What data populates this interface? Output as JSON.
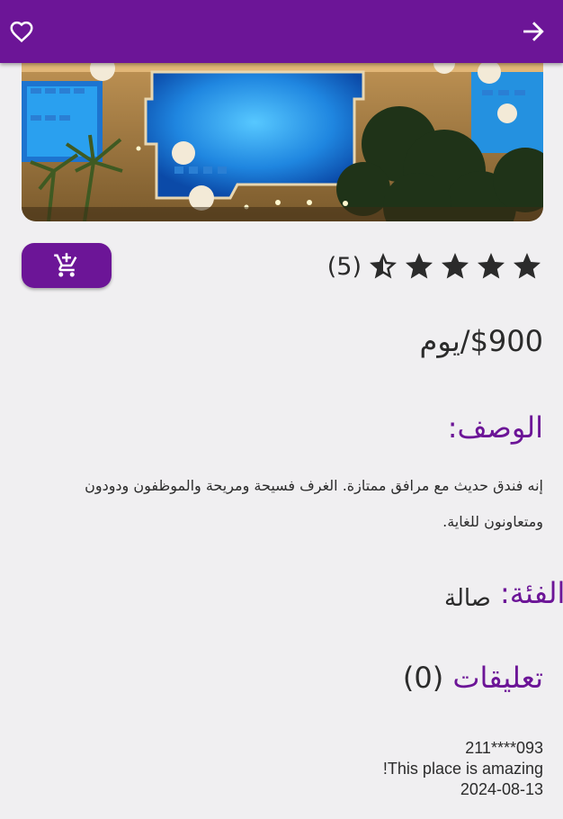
{
  "header": {
    "favorite_icon": "heart-outline-icon",
    "forward_icon": "arrow-forward-icon"
  },
  "hero": {
    "image": "hotel-pool-night-aerial"
  },
  "actions": {
    "add_to_cart_icon": "add-shopping-cart-icon"
  },
  "rating": {
    "value": 4.5,
    "max": 5,
    "count_text": "(5)"
  },
  "price": {
    "text": "$900/يوم"
  },
  "description": {
    "title": "الوصف:",
    "text": "إنه فندق حديث مع مرافق ممتازة. الغرف فسيحة ومريحة والموظفون ودودون ومتعاونون للغاية."
  },
  "category": {
    "label": "الفئة:",
    "value": "صالة"
  },
  "comments": {
    "title": "تعليقات",
    "count_text": "(0)",
    "items": [
      {
        "user": "211****093",
        "text": "This place is amazing!",
        "date": "2024-08-13"
      }
    ]
  },
  "colors": {
    "primary": "#6c1597",
    "background": "#f0eff1",
    "text": "#2b2b2b"
  }
}
